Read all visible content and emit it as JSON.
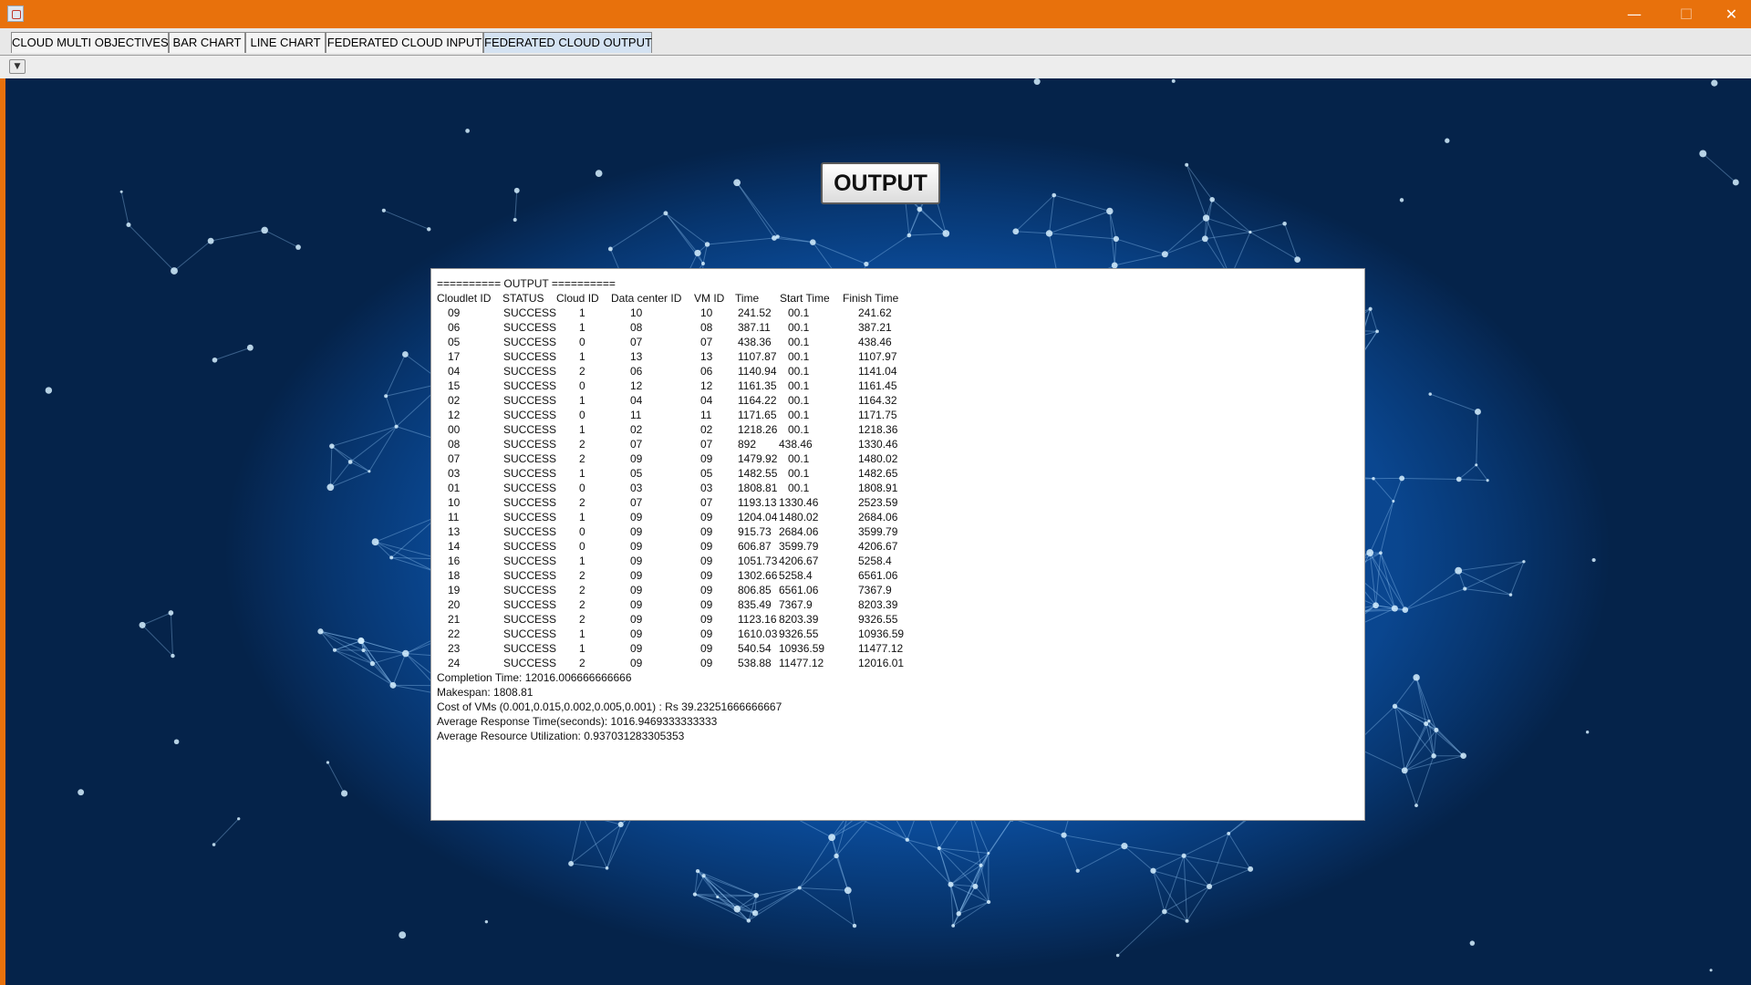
{
  "window": {
    "minimize_glyph": "—",
    "maximize_glyph": "☐",
    "close_glyph": "✕"
  },
  "tabs": [
    {
      "label": "CLOUD MULTI OBJECTIVES",
      "active": false
    },
    {
      "label": "BAR CHART",
      "active": false
    },
    {
      "label": "LINE CHART",
      "active": false
    },
    {
      "label": "FEDERATED CLOUD INPUT",
      "active": false
    },
    {
      "label": "FEDERATED CLOUD OUTPUT",
      "active": true
    }
  ],
  "toolbar": {
    "dropdown_glyph": "▼"
  },
  "output_button": {
    "label": "OUTPUT"
  },
  "output": {
    "header_line": "========== OUTPUT ==========",
    "columns": [
      "Cloudlet ID",
      "STATUS",
      "Cloud ID",
      "Data center ID",
      "VM ID",
      "Time",
      "Start Time",
      "Finish Time"
    ],
    "rows": [
      [
        "09",
        "SUCCESS",
        "1",
        "10",
        "10",
        "241.52",
        "00.1",
        "241.62"
      ],
      [
        "06",
        "SUCCESS",
        "1",
        "08",
        "08",
        "387.11",
        "00.1",
        "387.21"
      ],
      [
        "05",
        "SUCCESS",
        "0",
        "07",
        "07",
        "438.36",
        "00.1",
        "438.46"
      ],
      [
        "17",
        "SUCCESS",
        "1",
        "13",
        "13",
        "1107.87",
        "00.1",
        "1107.97"
      ],
      [
        "04",
        "SUCCESS",
        "2",
        "06",
        "06",
        "1140.94",
        "00.1",
        "1141.04"
      ],
      [
        "15",
        "SUCCESS",
        "0",
        "12",
        "12",
        "1161.35",
        "00.1",
        "1161.45"
      ],
      [
        "02",
        "SUCCESS",
        "1",
        "04",
        "04",
        "1164.22",
        "00.1",
        "1164.32"
      ],
      [
        "12",
        "SUCCESS",
        "0",
        "11",
        "11",
        "1171.65",
        "00.1",
        "1171.75"
      ],
      [
        "00",
        "SUCCESS",
        "1",
        "02",
        "02",
        "1218.26",
        "00.1",
        "1218.36"
      ],
      [
        "08",
        "SUCCESS",
        "2",
        "07",
        "07",
        "892",
        "438.46",
        "1330.46"
      ],
      [
        "07",
        "SUCCESS",
        "2",
        "09",
        "09",
        "1479.92",
        "00.1",
        "1480.02"
      ],
      [
        "03",
        "SUCCESS",
        "1",
        "05",
        "05",
        "1482.55",
        "00.1",
        "1482.65"
      ],
      [
        "01",
        "SUCCESS",
        "0",
        "03",
        "03",
        "1808.81",
        "00.1",
        "1808.91"
      ],
      [
        "10",
        "SUCCESS",
        "2",
        "07",
        "07",
        "1193.13",
        "1330.46",
        "2523.59"
      ],
      [
        "11",
        "SUCCESS",
        "1",
        "09",
        "09",
        "1204.04",
        "1480.02",
        "2684.06"
      ],
      [
        "13",
        "SUCCESS",
        "0",
        "09",
        "09",
        "915.73",
        "2684.06",
        "3599.79"
      ],
      [
        "14",
        "SUCCESS",
        "0",
        "09",
        "09",
        "606.87",
        "3599.79",
        "4206.67"
      ],
      [
        "16",
        "SUCCESS",
        "1",
        "09",
        "09",
        "1051.73",
        "4206.67",
        "5258.4"
      ],
      [
        "18",
        "SUCCESS",
        "2",
        "09",
        "09",
        "1302.66",
        "5258.4",
        "6561.06"
      ],
      [
        "19",
        "SUCCESS",
        "2",
        "09",
        "09",
        "806.85",
        "6561.06",
        "7367.9"
      ],
      [
        "20",
        "SUCCESS",
        "2",
        "09",
        "09",
        "835.49",
        "7367.9",
        "8203.39"
      ],
      [
        "21",
        "SUCCESS",
        "2",
        "09",
        "09",
        "1123.16",
        "8203.39",
        "9326.55"
      ],
      [
        "22",
        "SUCCESS",
        "1",
        "09",
        "09",
        "1610.03",
        "9326.55",
        "10936.59"
      ],
      [
        "23",
        "SUCCESS",
        "1",
        "09",
        "09",
        "540.54",
        "10936.59",
        "11477.12"
      ],
      [
        "24",
        "SUCCESS",
        "2",
        "09",
        "09",
        "538.88",
        "11477.12",
        "12016.01"
      ]
    ],
    "summary": [
      "Completion Time: 12016.006666666666",
      "Makespan:  1808.81",
      "Cost of VMs (0.001,0.015,0.002,0.005,0.001) : Rs 39.23251666666667",
      "Average Response Time(seconds): 1016.9469333333333",
      "Average Resource Utilization: 0.937031283305353"
    ]
  }
}
